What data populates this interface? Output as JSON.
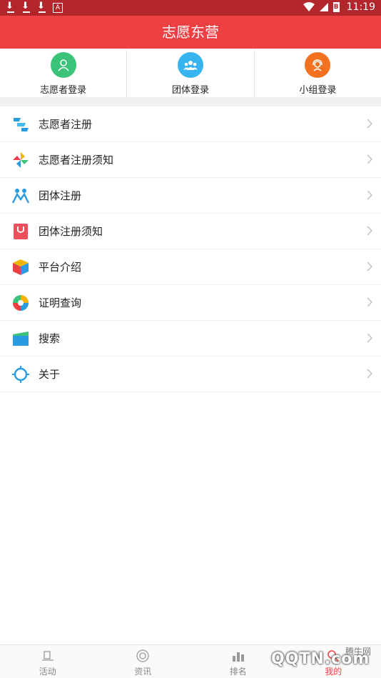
{
  "status_bar": {
    "time": "11:19",
    "battery_badge": "B"
  },
  "header": {
    "title": "志愿东营"
  },
  "logins": [
    {
      "label": "志愿者登录",
      "icon": "volunteer-user-icon",
      "color": "#3cc37a"
    },
    {
      "label": "团体登录",
      "icon": "group-users-icon",
      "color": "#36b4f0"
    },
    {
      "label": "小组登录",
      "icon": "team-headset-icon",
      "color": "#f4711f"
    }
  ],
  "menu": [
    {
      "label": "志愿者注册",
      "icon": "register-icon"
    },
    {
      "label": "志愿者注册须知",
      "icon": "pinwheel-icon"
    },
    {
      "label": "团体注册",
      "icon": "people-icon"
    },
    {
      "label": "团体注册须知",
      "icon": "bag-icon"
    },
    {
      "label": "平台介绍",
      "icon": "cube-icon"
    },
    {
      "label": "证明查询",
      "icon": "aperture-icon"
    },
    {
      "label": "搜索",
      "icon": "card-icon"
    },
    {
      "label": "关于",
      "icon": "gear-icon"
    }
  ],
  "tabbar": {
    "tabs": [
      {
        "label": "活动",
        "icon": "hat-icon"
      },
      {
        "label": "资讯",
        "icon": "target-icon"
      },
      {
        "label": "排名",
        "icon": "rank-icon"
      },
      {
        "label": "我的",
        "icon": "profile-icon"
      }
    ]
  },
  "watermark": {
    "site": "腾牛网",
    "logo": "QQTN.com"
  },
  "colors": {
    "status_bar": "#b3262c",
    "header": "#ee4043",
    "accent": "#ee4043"
  }
}
